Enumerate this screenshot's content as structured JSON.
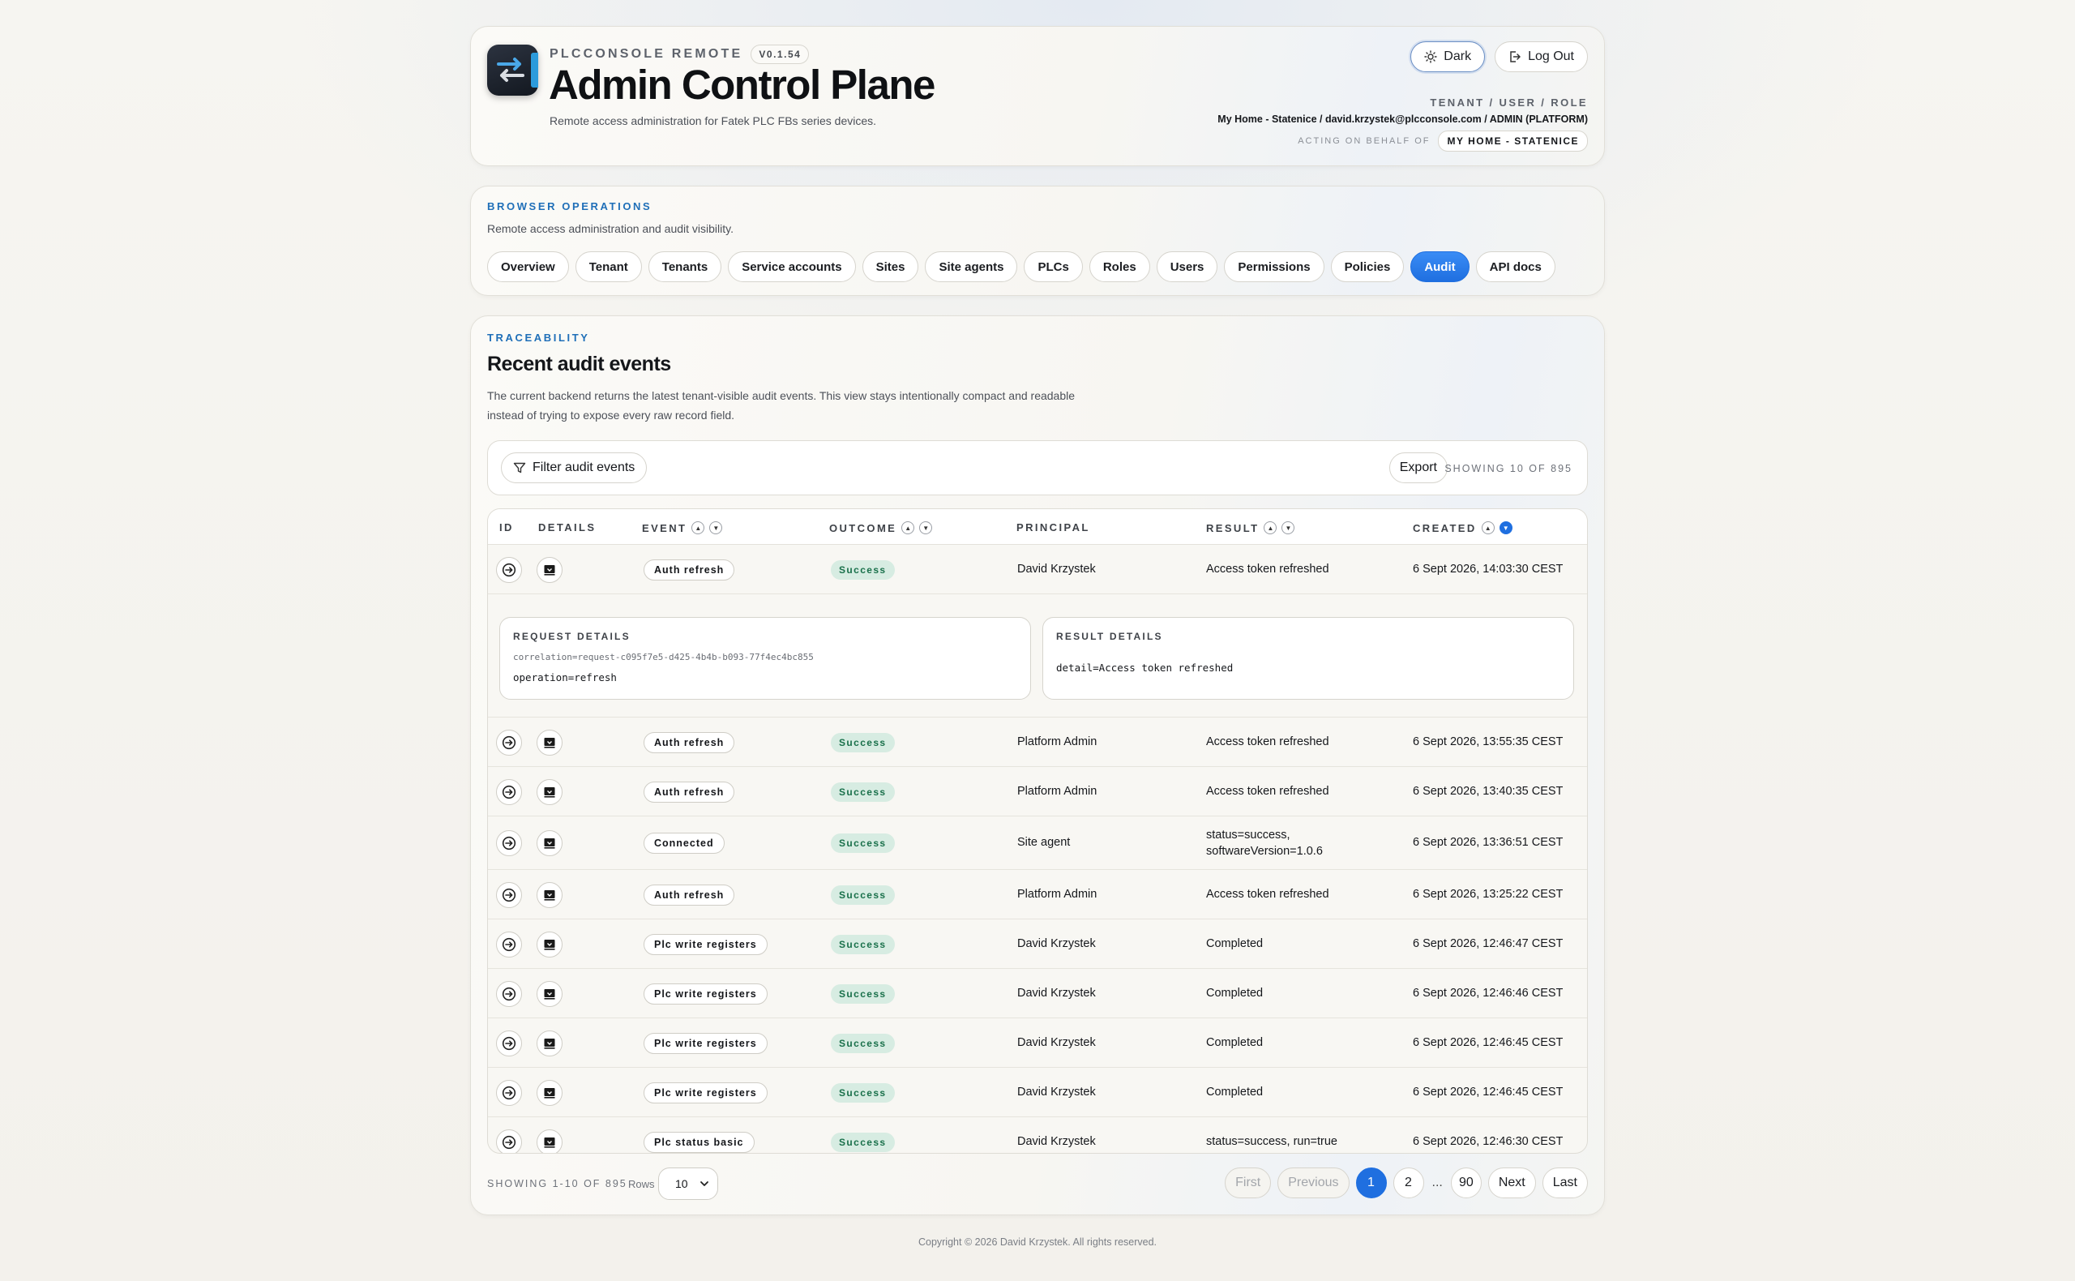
{
  "app": {
    "eyebrow": "PLCCONSOLE REMOTE",
    "version": "V0.1.54",
    "title": "Admin Control Plane",
    "subtitle": "Remote access administration for Fatek PLC FBs series devices."
  },
  "header": {
    "theme_label": "Dark",
    "logout_label": "Log Out",
    "tur_label": "TENANT / USER / ROLE",
    "tur_value": "My Home - Statenice / david.krzystek@plcconsole.com / ADMIN (PLATFORM)",
    "behalf_label": "ACTING ON BEHALF OF",
    "behalf_value": "MY HOME - STATENICE"
  },
  "ops": {
    "eyebrow": "BROWSER OPERATIONS",
    "description": "Remote access administration and audit visibility.",
    "tabs": [
      "Overview",
      "Tenant",
      "Tenants",
      "Service accounts",
      "Sites",
      "Site agents",
      "PLCs",
      "Roles",
      "Users",
      "Permissions",
      "Policies",
      "Audit",
      "API docs"
    ],
    "active_tab": "Audit"
  },
  "audit": {
    "eyebrow": "TRACEABILITY",
    "title": "Recent audit events",
    "description": "The current backend returns the latest tenant-visible audit events. This view stays intentionally compact and readable instead of trying to expose every raw record field.",
    "filter_label": "Filter audit events",
    "export_label": "Export",
    "showing_top": "SHOWING 10 OF 895",
    "columns": [
      "ID",
      "DETAILS",
      "EVENT",
      "OUTCOME",
      "PRINCIPAL",
      "RESULT",
      "CREATED"
    ],
    "details": {
      "request_label": "REQUEST DETAILS",
      "request_correlation": "correlation=request-c095f7e5-d425-4b4b-b093-77f4ec4bc855",
      "request_operation": "operation=refresh",
      "result_label": "RESULT DETAILS",
      "result_detail": "detail=Access token refreshed"
    },
    "rows": [
      {
        "event": "Auth refresh",
        "outcome": "Success",
        "principal": "David Krzystek",
        "result": "Access token refreshed",
        "created": "6 Sept 2026, 14:03:30 CEST"
      },
      {
        "event": "Auth refresh",
        "outcome": "Success",
        "principal": "Platform Admin",
        "result": "Access token refreshed",
        "created": "6 Sept 2026, 13:55:35 CEST"
      },
      {
        "event": "Auth refresh",
        "outcome": "Success",
        "principal": "Platform Admin",
        "result": "Access token refreshed",
        "created": "6 Sept 2026, 13:40:35 CEST"
      },
      {
        "event": "Connected",
        "outcome": "Success",
        "principal": "Site agent",
        "result": "status=success, softwareVersion=1.0.6",
        "created": "6 Sept 2026, 13:36:51 CEST"
      },
      {
        "event": "Auth refresh",
        "outcome": "Success",
        "principal": "Platform Admin",
        "result": "Access token refreshed",
        "created": "6 Sept 2026, 13:25:22 CEST"
      },
      {
        "event": "Plc write registers",
        "outcome": "Success",
        "principal": "David Krzystek",
        "result": "Completed",
        "created": "6 Sept 2026, 12:46:47 CEST"
      },
      {
        "event": "Plc write registers",
        "outcome": "Success",
        "principal": "David Krzystek",
        "result": "Completed",
        "created": "6 Sept 2026, 12:46:46 CEST"
      },
      {
        "event": "Plc write registers",
        "outcome": "Success",
        "principal": "David Krzystek",
        "result": "Completed",
        "created": "6 Sept 2026, 12:46:45 CEST"
      },
      {
        "event": "Plc write registers",
        "outcome": "Success",
        "principal": "David Krzystek",
        "result": "Completed",
        "created": "6 Sept 2026, 12:46:45 CEST"
      },
      {
        "event": "Plc status basic",
        "outcome": "Success",
        "principal": "David Krzystek",
        "result": "status=success, run=true",
        "created": "6 Sept 2026, 12:46:30 CEST"
      }
    ],
    "showing_bottom": "SHOWING 1-10 OF 895",
    "rows_label": "Rows",
    "rows_value": "10",
    "pager": {
      "first": "First",
      "previous": "Previous",
      "pages": [
        "1",
        "2"
      ],
      "ellipsis": "...",
      "last_page": "90",
      "next": "Next",
      "last": "Last"
    }
  },
  "footer": {
    "copyright": "Copyright © 2026 David Krzystek. All rights reserved."
  }
}
